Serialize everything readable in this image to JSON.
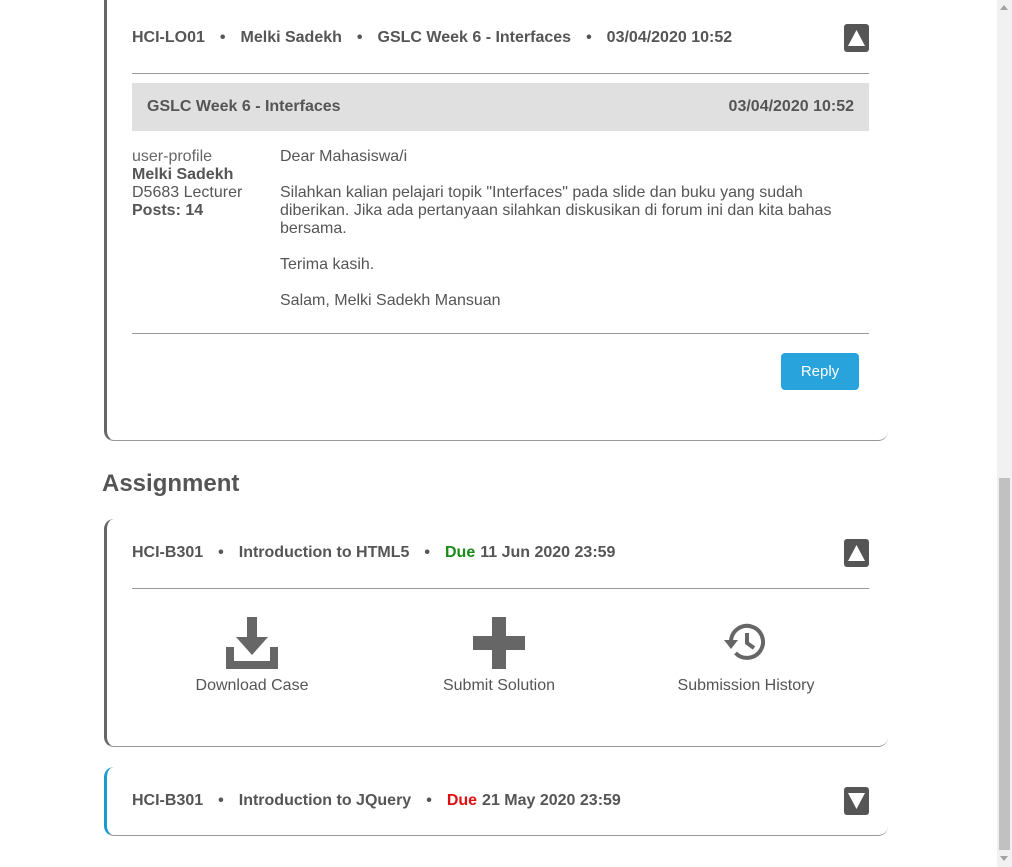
{
  "forum_card": {
    "header": {
      "code": "HCI-LO01",
      "author": "Melki Sadekh",
      "topic": "GSLC Week 6 - Interfaces",
      "datetime": "03/04/2020 10:52",
      "separator": "•"
    },
    "post": {
      "title": "GSLC Week 6 - Interfaces",
      "datetime": "03/04/2020 10:52",
      "author_image_alt": "user-profile",
      "author_name": "Melki Sadekh",
      "author_role": "D5683 Lecturer",
      "posts_label": "Posts: 14",
      "message": [
        "Dear Mahasiswa/i",
        "Silahkan kalian pelajari topik \"Interfaces\" pada slide dan buku yang sudah diberikan. Jika ada pertanyaan silahkan diskusikan di forum ini dan kita bahas bersama.",
        "Terima kasih.",
        "Salam, Melki Sadekh Mansuan"
      ]
    },
    "reply_label": "Reply"
  },
  "assignment_section": {
    "title": "Assignment",
    "items": [
      {
        "code": "HCI-B301",
        "title": "Introduction to HTML5",
        "due_label": "Due",
        "due_date": "11 Jun 2020 23:59",
        "due_color": "#1a8a1a",
        "expanded": true,
        "actions": [
          {
            "label": "Download Case",
            "icon": "download-icon"
          },
          {
            "label": "Submit Solution",
            "icon": "plus-icon"
          },
          {
            "label": "Submission History",
            "icon": "history-icon"
          }
        ]
      },
      {
        "code": "HCI-B301",
        "title": "Introduction to JQuery",
        "due_label": "Due",
        "due_date": "21 May 2020 23:59",
        "due_color": "#e01010",
        "expanded": false
      }
    ]
  },
  "colors": {
    "accent_blue": "#1a9bd0",
    "reply_button": "#29a3dc",
    "text": "#555555"
  }
}
